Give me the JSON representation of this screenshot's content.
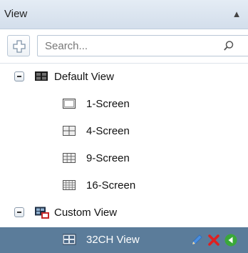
{
  "panel": {
    "title": "View"
  },
  "search": {
    "placeholder": "Search..."
  },
  "tree": {
    "default_group": {
      "label": "Default View",
      "items": [
        {
          "label": "1-Screen",
          "icon": "screen-1-icon"
        },
        {
          "label": "4-Screen",
          "icon": "screen-4-icon"
        },
        {
          "label": "9-Screen",
          "icon": "screen-9-icon"
        },
        {
          "label": "16-Screen",
          "icon": "screen-16-icon"
        }
      ]
    },
    "custom_group": {
      "label": "Custom View",
      "items": [
        {
          "label": "32CH View",
          "icon": "custom-view-icon",
          "selected": true
        }
      ]
    }
  },
  "colors": {
    "selection": "#5b7c9a",
    "header": "#d3deeb",
    "edit": "#4a8fe0",
    "delete": "#e02020",
    "play": "#3aa83a"
  }
}
